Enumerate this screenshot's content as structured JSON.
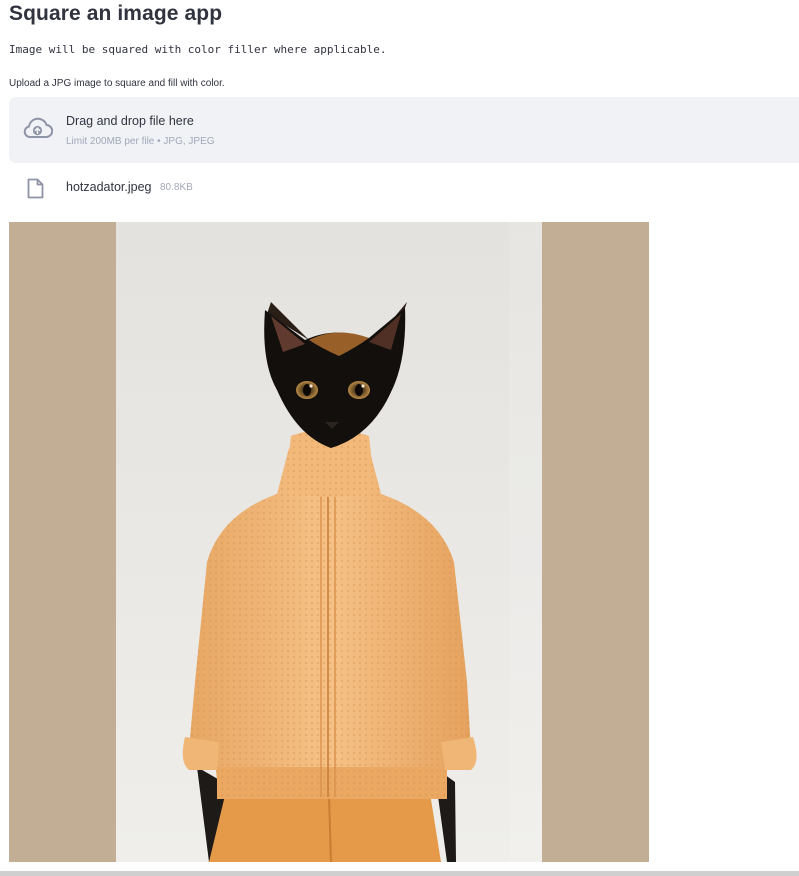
{
  "header": {
    "title": "Square an image app",
    "subtitle": "Image will be squared with color filler where applicable."
  },
  "uploader": {
    "label": "Upload a JPG image to square and fill with color.",
    "drop_text": "Drag and drop file here",
    "limit_text": "Limit 200MB per file • JPG, JPEG",
    "icon": "cloud-upload-icon"
  },
  "file": {
    "name": "hotzadator.jpeg",
    "size": "80.8KB",
    "icon": "file-icon"
  },
  "image": {
    "filler_color": "#c2ad95",
    "background_color": "#e9e7e3"
  },
  "colors": {
    "dropzone_bg": "#f0f2f6",
    "text": "#31333f",
    "muted": "#a3a8b8"
  }
}
